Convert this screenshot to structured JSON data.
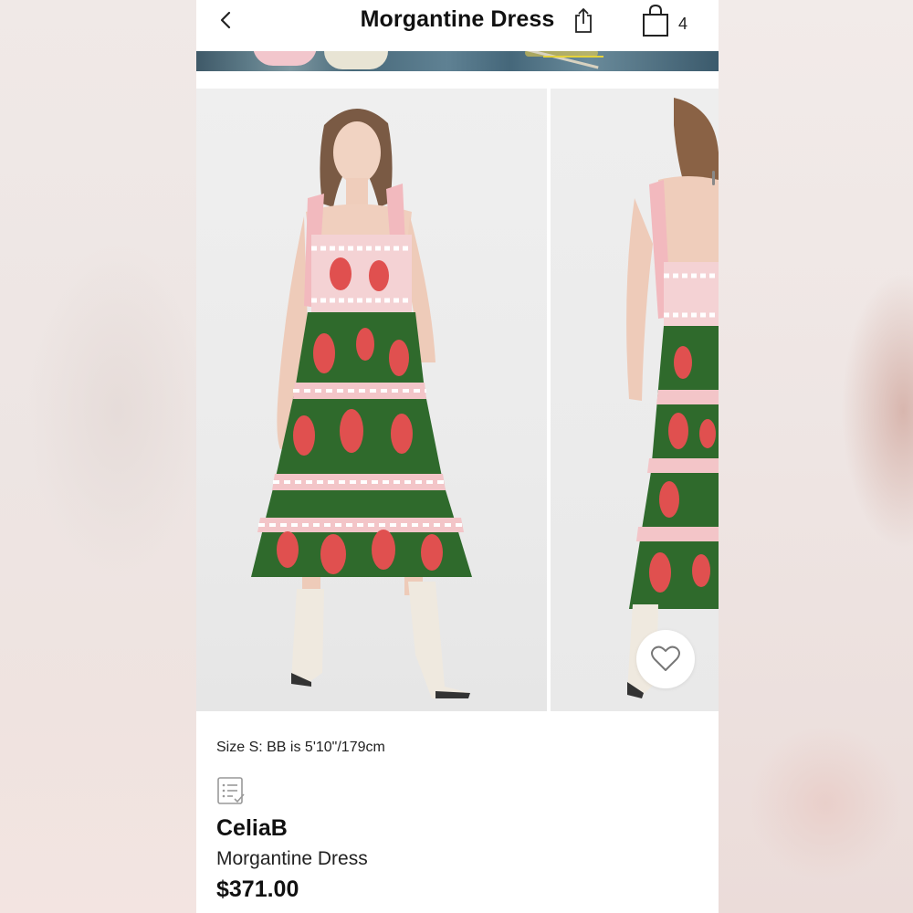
{
  "header": {
    "title": "Morgantine Dress",
    "bag_count": "4",
    "icons": {
      "back": "chevron-left-icon",
      "share": "share-icon",
      "bag": "shopping-bag-icon"
    }
  },
  "gallery": {
    "images": [
      {
        "view": "front",
        "description_icon": "product-photo"
      },
      {
        "view": "back",
        "description_icon": "product-photo"
      }
    ],
    "favorite_icon": "heart-icon"
  },
  "product": {
    "size_note": "Size S: BB is 5'10\"/179cm",
    "reviews_icon": "reviews-list-icon",
    "brand": "CeliaB",
    "name": "Morgantine Dress",
    "price": "$371.00"
  },
  "colors": {
    "dress_green": "#2f6a2c",
    "dress_red": "#e0504f",
    "dress_pink": "#f0a9ad",
    "text": "#111111"
  }
}
